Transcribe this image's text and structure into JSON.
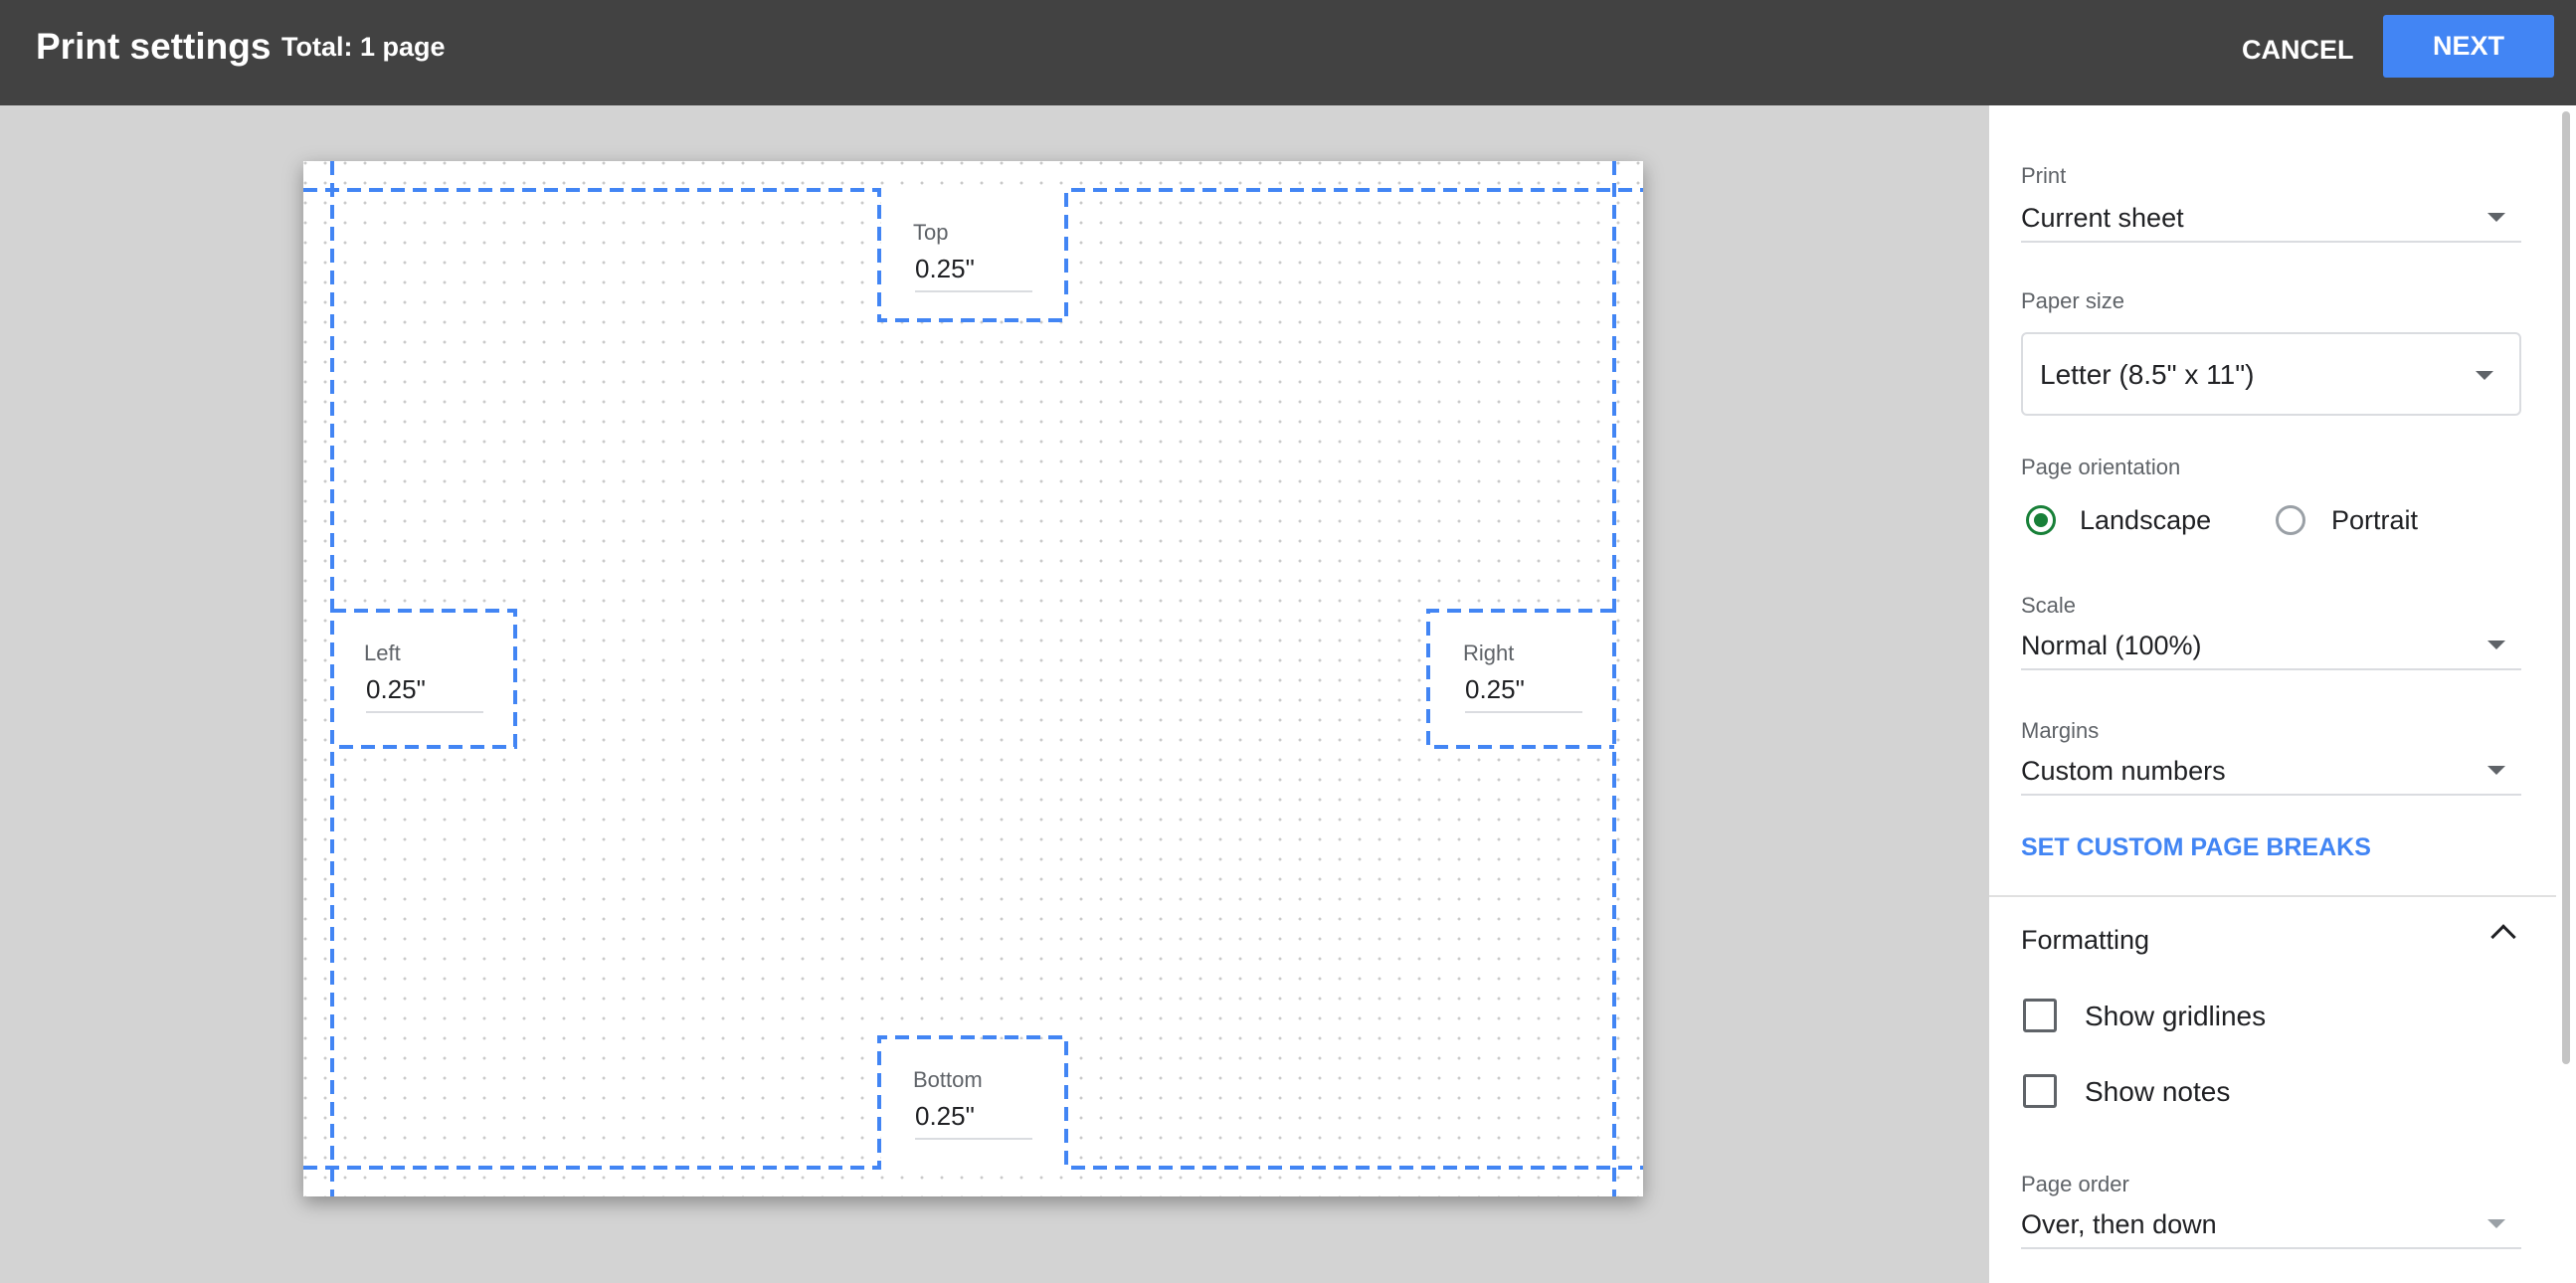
{
  "header": {
    "title": "Print settings",
    "total": "Total: 1 page",
    "cancel_label": "CANCEL",
    "next_label": "NEXT"
  },
  "margins": {
    "top": {
      "label": "Top",
      "value": "0.25\""
    },
    "left": {
      "label": "Left",
      "value": "0.25\""
    },
    "right": {
      "label": "Right",
      "value": "0.25\""
    },
    "bottom": {
      "label": "Bottom",
      "value": "0.25\""
    }
  },
  "settings": {
    "print": {
      "label": "Print",
      "value": "Current sheet"
    },
    "paper_size": {
      "label": "Paper size",
      "value": "Letter (8.5\" x 11\")"
    },
    "orientation": {
      "label": "Page orientation",
      "options": [
        "Landscape",
        "Portrait"
      ],
      "selected": "Landscape"
    },
    "scale": {
      "label": "Scale",
      "value": "Normal (100%)"
    },
    "margins": {
      "label": "Margins",
      "value": "Custom numbers"
    },
    "custom_breaks_label": "SET CUSTOM PAGE BREAKS",
    "formatting": {
      "title": "Formatting",
      "show_gridlines": {
        "label": "Show gridlines",
        "checked": false
      },
      "show_notes": {
        "label": "Show notes",
        "checked": false
      }
    },
    "page_order": {
      "label": "Page order",
      "value": "Over, then down"
    }
  },
  "colors": {
    "accent": "#4285f4",
    "header_bg": "#424242",
    "radio_selected": "#188038",
    "margin_guide": "#4285f4"
  },
  "icons": [
    "caret-down-icon",
    "chevron-up-icon"
  ]
}
